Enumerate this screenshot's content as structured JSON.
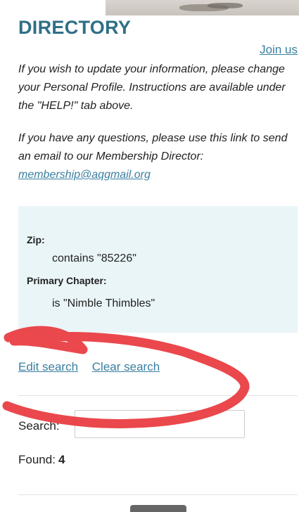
{
  "header": {
    "title": "DIRECTORY",
    "join_link": "Join us"
  },
  "info": {
    "update_text": "If you wish to update your information, please change your Personal Profile.  Instructions are available under the \"HELP!\" tab above.",
    "questions_text": "If you have any questions, please use this link to send an email to our Membership Director: ",
    "email": "membership@aqgmail.org"
  },
  "criteria": {
    "zip_label": "Zip:",
    "zip_value": "contains \"85226\"",
    "chapter_label": "Primary Chapter:",
    "chapter_value": "is \"Nimble Thimbles\""
  },
  "actions": {
    "edit_search": "Edit search",
    "clear_search": "Clear search"
  },
  "search": {
    "label": "Search:",
    "value": ""
  },
  "results": {
    "found_label": "Found:",
    "found_count": "4"
  },
  "colors": {
    "title": "#2f6f86",
    "link": "#3a7fa0",
    "criteria_bg": "#eaf5f8",
    "annotation": "#e8383d"
  }
}
